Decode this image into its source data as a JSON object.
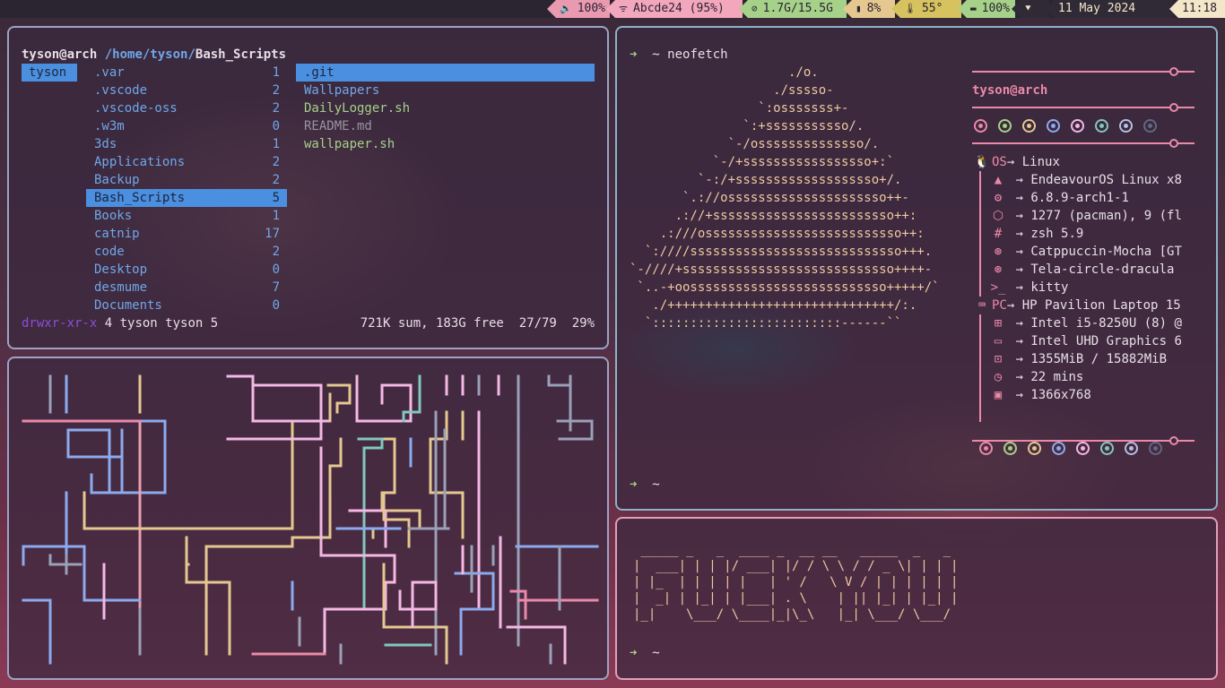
{
  "topbar": {
    "segments": [
      {
        "icon": "volume-icon",
        "glyph": "🔈",
        "text": "100%",
        "bg": "#ea9ab0"
      },
      {
        "icon": "wifi-icon",
        "glyph": "ᯤ",
        "text": "Abcde24 (95%)",
        "bg": "#f2a7bc"
      },
      {
        "icon": "memory-icon",
        "glyph": "⊘",
        "text": "1.7G/15.5G",
        "bg": "#a6d189"
      },
      {
        "icon": "cpu-icon",
        "glyph": "▮",
        "text": "8%",
        "bg": "#e5c890"
      },
      {
        "icon": "thermometer-icon",
        "glyph": "🌡",
        "text": "55°",
        "bg": "#d6c25f"
      },
      {
        "icon": "battery-icon",
        "glyph": "▬",
        "text": "100%",
        "bg": "#a6d189"
      },
      {
        "icon": "network-icon",
        "glyph": "⯆",
        "text": "",
        "bg": "#2f2a36"
      },
      {
        "icon": "date-text",
        "glyph": "",
        "text": "11 May 2024",
        "bg": "#2f2a36"
      },
      {
        "icon": "clock-text",
        "glyph": "",
        "text": "11:18",
        "bg": "#f4e6c8"
      }
    ]
  },
  "ranger": {
    "user_host": "tyson@arch",
    "path_prefix": "/home/tyson/",
    "path_current": "Bash_Scripts",
    "col1": [
      "tyson"
    ],
    "col2": [
      {
        "name": ".var",
        "count": "1"
      },
      {
        "name": ".vscode",
        "count": "2"
      },
      {
        "name": ".vscode-oss",
        "count": "2"
      },
      {
        "name": ".w3m",
        "count": "0"
      },
      {
        "name": "3ds",
        "count": "1"
      },
      {
        "name": "Applications",
        "count": "2"
      },
      {
        "name": "Backup",
        "count": "2"
      },
      {
        "name": "Bash_Scripts",
        "count": "5"
      },
      {
        "name": "Books",
        "count": "1"
      },
      {
        "name": "catnip",
        "count": "17"
      },
      {
        "name": "code",
        "count": "2"
      },
      {
        "name": "Desktop",
        "count": "0"
      },
      {
        "name": "desmume",
        "count": "7"
      },
      {
        "name": "Documents",
        "count": "0"
      }
    ],
    "col3": [
      {
        "name": ".git",
        "color": "#6fa8e8"
      },
      {
        "name": "Wallpapers",
        "color": "#6fa8e8"
      },
      {
        "name": "DailyLogger.sh",
        "color": "#a6d189"
      },
      {
        "name": "README.md",
        "color": "#9a93a0"
      },
      {
        "name": "wallpaper.sh",
        "color": "#a6d189"
      }
    ],
    "status_perm": "drwxr-xr-x",
    "status_meta": " 4 tyson tyson 5",
    "status_right": "721K sum, 183G free  27/79  29%"
  },
  "neofetch": {
    "prompt_arrow": "➜",
    "prompt_dir": "~",
    "command": "neofetch",
    "logo": [
      "                     ./o.",
      "                   ./sssso-",
      "                 `:osssssss+-",
      "               `:+sssssssssso/.",
      "             `-/ossssssssssssso/.",
      "           `-/+sssssssssssssssso+:`",
      "         `-:/+sssssssssssssssssso+/.",
      "       `.://osssssssssssssssssssso++-",
      "      .://+ssssssssssssssssssssssso++:",
      "    .:///ossssssssssssssssssssssssso++:",
      "  `:////ssssssssssssssssssssssssssso+++.",
      "`-////+ssssssssssssssssssssssssssso++++-",
      " `..-+oossssssssssssssssssssssssso+++++/`",
      "   ./++++++++++++++++++++++++++++++/:.",
      "  `:::::::::::::::::::::::::------``"
    ],
    "user": "tyson",
    "host": "arch",
    "dot_colors": [
      "#ea8aa8",
      "#a6d189",
      "#e5c890",
      "#8caaee",
      "#f4b8e4",
      "#81c8be",
      "#b5bfe2",
      "#626880"
    ],
    "os_label": "OS",
    "os_value": "Linux",
    "os_rows": [
      {
        "icon": "arch-icon",
        "glyph": "▲",
        "value": "EndeavourOS Linux x8"
      },
      {
        "icon": "gear-icon",
        "glyph": "⚙",
        "value": "6.8.9-arch1-1"
      },
      {
        "icon": "package-icon",
        "glyph": "⬡",
        "value": "1277 (pacman), 9 (fl"
      },
      {
        "icon": "hash-icon",
        "glyph": "#",
        "value": "zsh 5.9"
      }
    ],
    "theme_rows": [
      {
        "icon": "brush-icon",
        "glyph": "⊛",
        "value": "Catppuccin-Mocha [GT"
      },
      {
        "icon": "brush-icon",
        "glyph": "⊛",
        "value": "Tela-circle-dracula"
      },
      {
        "icon": "terminal-icon",
        "glyph": ">_",
        "value": "kitty"
      }
    ],
    "pc_label": "PC",
    "pc_value": "HP Pavilion Laptop 15",
    "pc_rows": [
      {
        "icon": "cpu-icon",
        "glyph": "⊞",
        "value": "Intel i5-8250U (8) @"
      },
      {
        "icon": "monitor-icon",
        "glyph": "▭",
        "value": "Intel UHD Graphics 6"
      },
      {
        "icon": "chip-icon",
        "glyph": "⊡",
        "value": "1355MiB / 15882MiB"
      },
      {
        "icon": "clock-icon",
        "glyph": "◷",
        "value": "22 mins"
      },
      {
        "icon": "image-icon",
        "glyph": "▣",
        "value": "1366x768"
      }
    ],
    "arrow": "→",
    "prompt2_arrow": "➜",
    "prompt2_dir": "~"
  },
  "figlet": {
    "lines": [
      " _____ _   _  ____ _  __ __   _____  _   _",
      "|  ___| | | |/ ___| |/ / \\ \\ / / _ \\| | | |",
      "| |_  | | | | |   | ' /   \\ V / | | | | | |",
      "|  _| | |_| | |___| . \\    | || |_| | |_| |",
      "|_|    \\___/ \\____|_|\\_\\   |_| \\___/ \\___/"
    ],
    "prompt_arrow": "➜",
    "prompt_dir": "~"
  }
}
